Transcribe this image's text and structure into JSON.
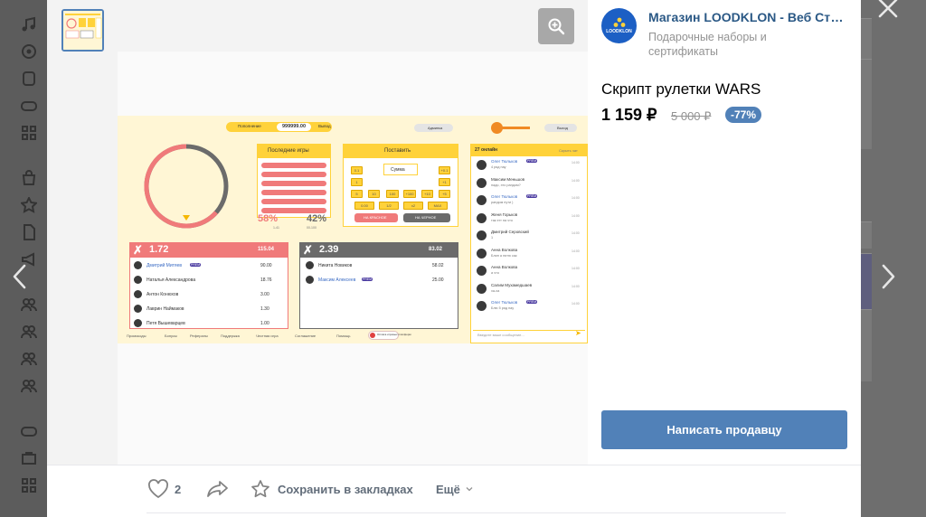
{
  "shop": {
    "name": "Магазин LOODKLON - Веб Студия",
    "category": "Подарочные наборы и сертификаты",
    "avatar_text": "LOODKLON"
  },
  "product": {
    "title": "Скрипт рулетки WARS",
    "price": "1 159 ₽",
    "old_price": "5 000 ₽",
    "discount": "-77%"
  },
  "actions": {
    "write_seller": "Написать продавцу",
    "likes_count": "2",
    "save_bookmarks": "Сохранить в закладках",
    "more": "Ещё"
  },
  "colors": {
    "accent": "#5181b8",
    "shop_name": "#2a5885",
    "mock_yellow": "#ffd23a",
    "mock_red": "#f07a7a",
    "mock_gray": "#6b6b6b"
  },
  "mockup": {
    "balance_label": "Пополнение",
    "balance": "999999.00",
    "withdraw": "Вывод",
    "admin": "Админка",
    "logout": "Выход",
    "last_games": "Последние игры",
    "place_bet": "Поставить",
    "sum_placeholder": "Сумма",
    "bet_buttons": [
      "0.1",
      "+0.1",
      "1",
      "+1",
      "5",
      "10",
      "100",
      "+100",
      "+10",
      "+5",
      "0.00",
      "1/2",
      "x2",
      "MAX"
    ],
    "bet_red": "НА КРАСНОЕ",
    "bet_black": "НА ЧЕРНОЕ",
    "red_percent": "58%",
    "black_percent": "42%",
    "red_sub": "1-41",
    "black_sub": "00-100",
    "red_mult": "1.72",
    "red_total": "115.04",
    "red_players": [
      {
        "name": "Дмитрий Митяев",
        "value": "90.00",
        "prem": true
      },
      {
        "name": "Наталья Александрова",
        "value": "18.76",
        "prem": false
      },
      {
        "name": "Антон Конюхов",
        "value": "3.00",
        "prem": false
      },
      {
        "name": "Лаврин Наймаков",
        "value": "1.30",
        "prem": false
      },
      {
        "name": "Петя Вышеварцев",
        "value": "1.00",
        "prem": false
      }
    ],
    "black_mult": "2.39",
    "black_total": "83.02",
    "black_players": [
      {
        "name": "Никита Новиков",
        "value": "58.02",
        "prem": false
      },
      {
        "name": "Максим Алексеев",
        "value": "25.00",
        "prem": true
      }
    ],
    "chat_online": "27 онлайн",
    "chat_hide": "Скрыть чат",
    "chat_messages": [
      {
        "name": "Олег Тюльков",
        "text": "4 ряд пау",
        "time": "14:00",
        "prem": true
      },
      {
        "name": "Максим Меньшов",
        "text": "надо, это рандом?",
        "time": "14:00",
        "prem": false
      },
      {
        "name": "Олег Тюльков",
        "text": "рандом пути )",
        "time": "14:00",
        "prem": true
      },
      {
        "name": "Женя Горьков",
        "text": "так этт на что",
        "time": "14:00",
        "prem": false
      },
      {
        "name": "Дмитрий Серовский",
        "text": "1",
        "time": "14:00",
        "prem": false
      },
      {
        "name": "Анна Волкова",
        "text": "Блин а пятю сак",
        "time": "14:00",
        "prem": false
      },
      {
        "name": "Анна Волкова",
        "text": "а что",
        "time": "14:00",
        "prem": false
      },
      {
        "name": "Салим Мухамедшаев",
        "text": "ха-ха",
        "time": "14:00",
        "prem": false
      },
      {
        "name": "Олег Тюльков",
        "text": "Блю 5 ряд пау",
        "time": "14:00",
        "prem": true
      }
    ],
    "chat_placeholder": "Введите ваше сообщение...",
    "footer_links": [
      "Промокоды",
      "Бонусы",
      "Рефералы",
      "Поддержка",
      "Честная игра",
      "Соглашение",
      "Помощь"
    ],
    "prem_badge": "PREM",
    "footer_badge": "Оплата игровых платформ"
  },
  "icons": {
    "close": "close-icon",
    "zoom": "zoom-in-icon",
    "like": "heart-icon",
    "share": "share-icon",
    "bookmark": "star-icon",
    "prev": "chevron-left-icon",
    "next": "chevron-right-icon"
  }
}
